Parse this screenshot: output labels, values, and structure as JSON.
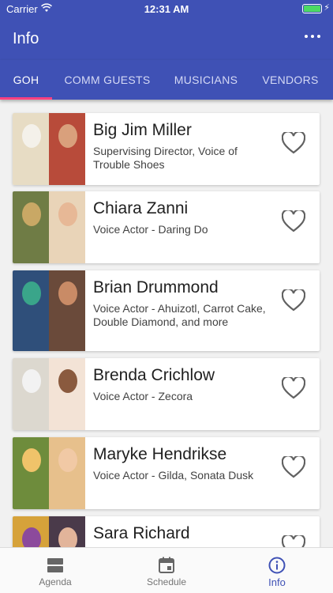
{
  "status": {
    "carrier": "Carrier",
    "time": "12:31 AM"
  },
  "appbar": {
    "title": "Info"
  },
  "tabs": [
    {
      "label": "GOH",
      "active": true
    },
    {
      "label": "COMM GUESTS",
      "active": false
    },
    {
      "label": "MUSICIANS",
      "active": false
    },
    {
      "label": "VENDORS",
      "active": false
    }
  ],
  "guests": [
    {
      "name": "Big Jim Miller",
      "role": "Supervising Director, Voice of Trouble Shoes",
      "favorite": false
    },
    {
      "name": "Chiara Zanni",
      "role": "Voice Actor - Daring Do",
      "favorite": false
    },
    {
      "name": "Brian Drummond",
      "role": "Voice Actor - Ahuizotl, Carrot Cake, Double Diamond, and more",
      "favorite": false
    },
    {
      "name": "Brenda Crichlow",
      "role": "Voice Actor - Zecora",
      "favorite": false
    },
    {
      "name": "Maryke Hendrikse",
      "role": "Voice Actor - Gilda, Sonata Dusk",
      "favorite": false
    },
    {
      "name": "Sara Richard",
      "role": "",
      "favorite": false
    }
  ],
  "bottom_nav": [
    {
      "label": "Agenda",
      "icon": "agenda-icon",
      "active": false
    },
    {
      "label": "Schedule",
      "icon": "calendar-icon",
      "active": false
    },
    {
      "label": "Info",
      "icon": "info-icon",
      "active": true
    }
  ],
  "colors": {
    "primary": "#3f51b5",
    "accent": "#ff4081",
    "battery": "#4cd964"
  }
}
